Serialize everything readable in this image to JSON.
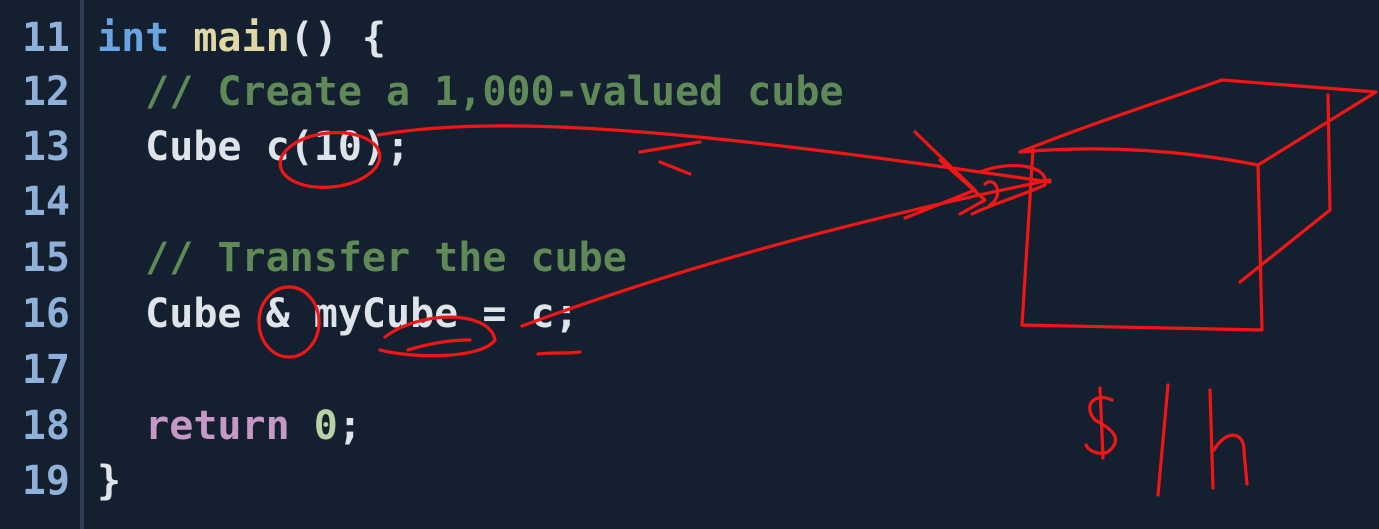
{
  "editor": {
    "lines": [
      {
        "number": "11",
        "tokens": [
          {
            "text": "int",
            "kind": "kw"
          },
          {
            "text": " ",
            "kind": "pl"
          },
          {
            "text": "main",
            "kind": "fn"
          },
          {
            "text": "() {",
            "kind": "pl"
          }
        ]
      },
      {
        "number": "12",
        "tokens": [
          {
            "text": "  // Create a 1,000-valued cube",
            "kind": "cm"
          }
        ]
      },
      {
        "number": "13",
        "tokens": [
          {
            "text": "  Cube c(10);",
            "kind": "pl"
          }
        ]
      },
      {
        "number": "14",
        "tokens": []
      },
      {
        "number": "15",
        "tokens": [
          {
            "text": "  // Transfer the cube",
            "kind": "cm"
          }
        ]
      },
      {
        "number": "16",
        "tokens": [
          {
            "text": "  Cube & myCube = c;",
            "kind": "pl"
          }
        ]
      },
      {
        "number": "17",
        "tokens": []
      },
      {
        "number": "18",
        "tokens": [
          {
            "text": "  ",
            "kind": "pl"
          },
          {
            "text": "return",
            "kind": "rt"
          },
          {
            "text": " ",
            "kind": "pl"
          },
          {
            "text": "0",
            "kind": "nm"
          },
          {
            "text": ";",
            "kind": "pl"
          }
        ]
      },
      {
        "number": "19",
        "tokens": [
          {
            "text": "}",
            "kind": "pl"
          }
        ]
      }
    ]
  },
  "annotation": {
    "handwritten_label": "$1h",
    "ink_color": "#f11616"
  }
}
